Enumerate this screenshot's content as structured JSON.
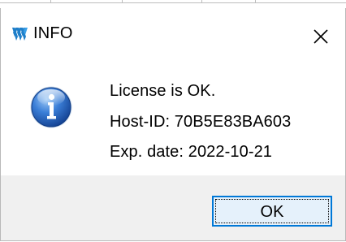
{
  "window": {
    "title": "INFO",
    "logo_icon": "app-logo-icon",
    "close_icon": "close-icon"
  },
  "message": {
    "icon": "info-icon",
    "line1": "License is OK.",
    "line2": "Host-ID: 70B5E83BA603",
    "line3": "Exp. date: 2022-10-21"
  },
  "buttons": {
    "ok_label": "OK"
  },
  "colors": {
    "button_border": "#0078d7",
    "button_fill": "#e5f1fb",
    "footer_bg": "#f0f0f0",
    "logo_blue": "#1f7fc9",
    "icon_blue": "#1e5db5"
  }
}
